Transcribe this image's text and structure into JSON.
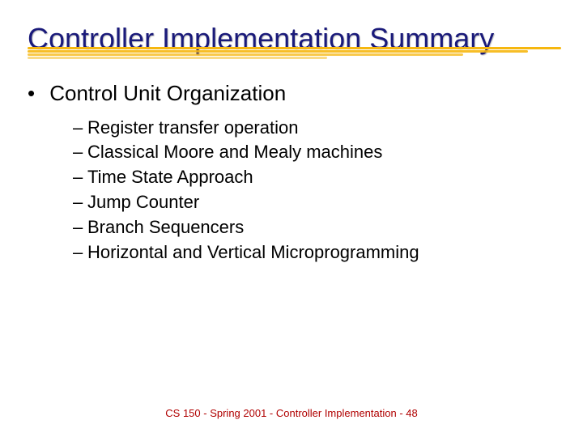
{
  "title": "Controller Implementation Summary",
  "section": {
    "heading": "Control Unit Organization",
    "items": [
      "Register transfer operation",
      "Classical Moore and Mealy machines",
      "Time State Approach",
      "Jump Counter",
      "Branch Sequencers",
      "Horizontal and Vertical Microprogramming"
    ]
  },
  "footer": "CS 150 - Spring 2001 - Controller Implementation - 48"
}
